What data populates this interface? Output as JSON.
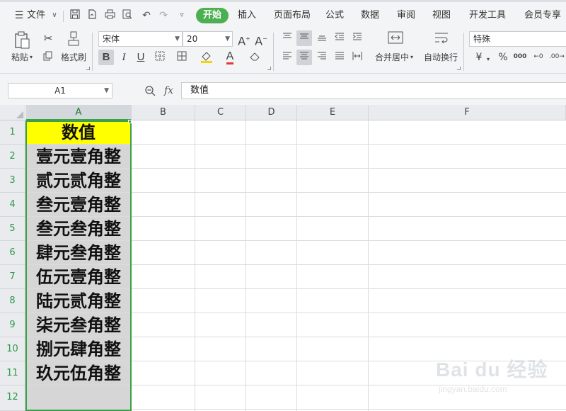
{
  "menu": {
    "file_label": "文件",
    "tabs": [
      {
        "label": "开始",
        "active": true
      },
      {
        "label": "插入"
      },
      {
        "label": "页面布局"
      },
      {
        "label": "公式"
      },
      {
        "label": "数据"
      },
      {
        "label": "审阅"
      },
      {
        "label": "视图"
      },
      {
        "label": "开发工具"
      },
      {
        "label": "会员专享"
      }
    ]
  },
  "ribbon": {
    "paste_label": "粘贴",
    "format_painter_label": "格式刷",
    "font_name": "宋体",
    "font_size": "20",
    "bold_label": "B",
    "italic_label": "I",
    "underline_label": "U",
    "merge_center_label": "合并居中",
    "wrap_text_label": "自动换行",
    "number_format": "特殊",
    "currency_symbol": "¥",
    "percent_symbol": "%",
    "thousands_symbol": "000"
  },
  "formula_bar": {
    "name_box": "A1",
    "fx_label": "fx",
    "content": "数值"
  },
  "sheet": {
    "columns": [
      "A",
      "B",
      "C",
      "D",
      "E",
      "F"
    ],
    "rows": [
      "1",
      "2",
      "3",
      "4",
      "5",
      "6",
      "7",
      "8",
      "9",
      "10",
      "11",
      "12"
    ],
    "column_a": [
      "数值",
      "壹元壹角整",
      "贰元贰角整",
      "叁元壹角整",
      "叁元叁角整",
      "肆元叁角整",
      "伍元壹角整",
      "陆元贰角整",
      "柒元叁角整",
      "捌元肆角整",
      "玖元伍角整",
      ""
    ],
    "selection_color": "#3aa14a",
    "header_fill": "#ffff00"
  },
  "watermark": {
    "brand": "Bai du 经验",
    "url": "jingyan.baidu.com"
  }
}
